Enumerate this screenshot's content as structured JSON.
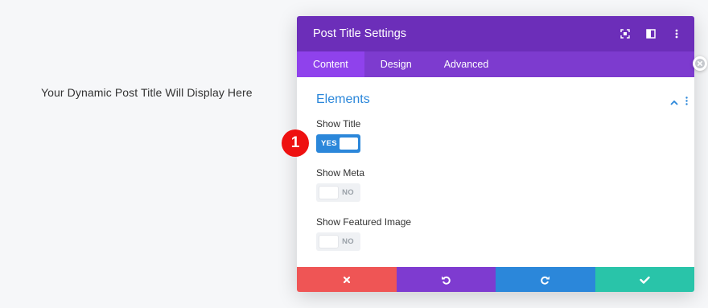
{
  "page": {
    "post_title_placeholder": "Your Dynamic Post Title Will Display Here"
  },
  "modal": {
    "title": "Post Title Settings",
    "header_icons": [
      "expand-icon",
      "split-view-icon",
      "more-options-icon"
    ],
    "tabs": [
      {
        "label": "Content",
        "active": true
      },
      {
        "label": "Design",
        "active": false
      },
      {
        "label": "Advanced",
        "active": false
      }
    ],
    "section": {
      "title": "Elements",
      "collapse_icon": "chevron-up-icon",
      "menu_icon": "kebab-icon"
    },
    "fields": [
      {
        "label": "Show Title",
        "state": "on",
        "toggle_text": "YES"
      },
      {
        "label": "Show Meta",
        "state": "off",
        "toggle_text": "NO"
      },
      {
        "label": "Show Featured Image",
        "state": "off",
        "toggle_text": "NO"
      }
    ],
    "footer": {
      "cancel_icon": "close-icon",
      "undo_icon": "undo-icon",
      "redo_icon": "redo-icon",
      "save_icon": "check-icon"
    }
  },
  "annotation": {
    "badge_number": "1"
  },
  "colors": {
    "header": "#6c2eb9",
    "tabs": "#7d3bcf",
    "active_tab": "#8f42ec",
    "accent": "#2b87da",
    "cancel": "#ef5555",
    "undo": "#7e3bd0",
    "redo": "#2b87da",
    "save": "#29c4a9",
    "badge": "#ee1111"
  }
}
